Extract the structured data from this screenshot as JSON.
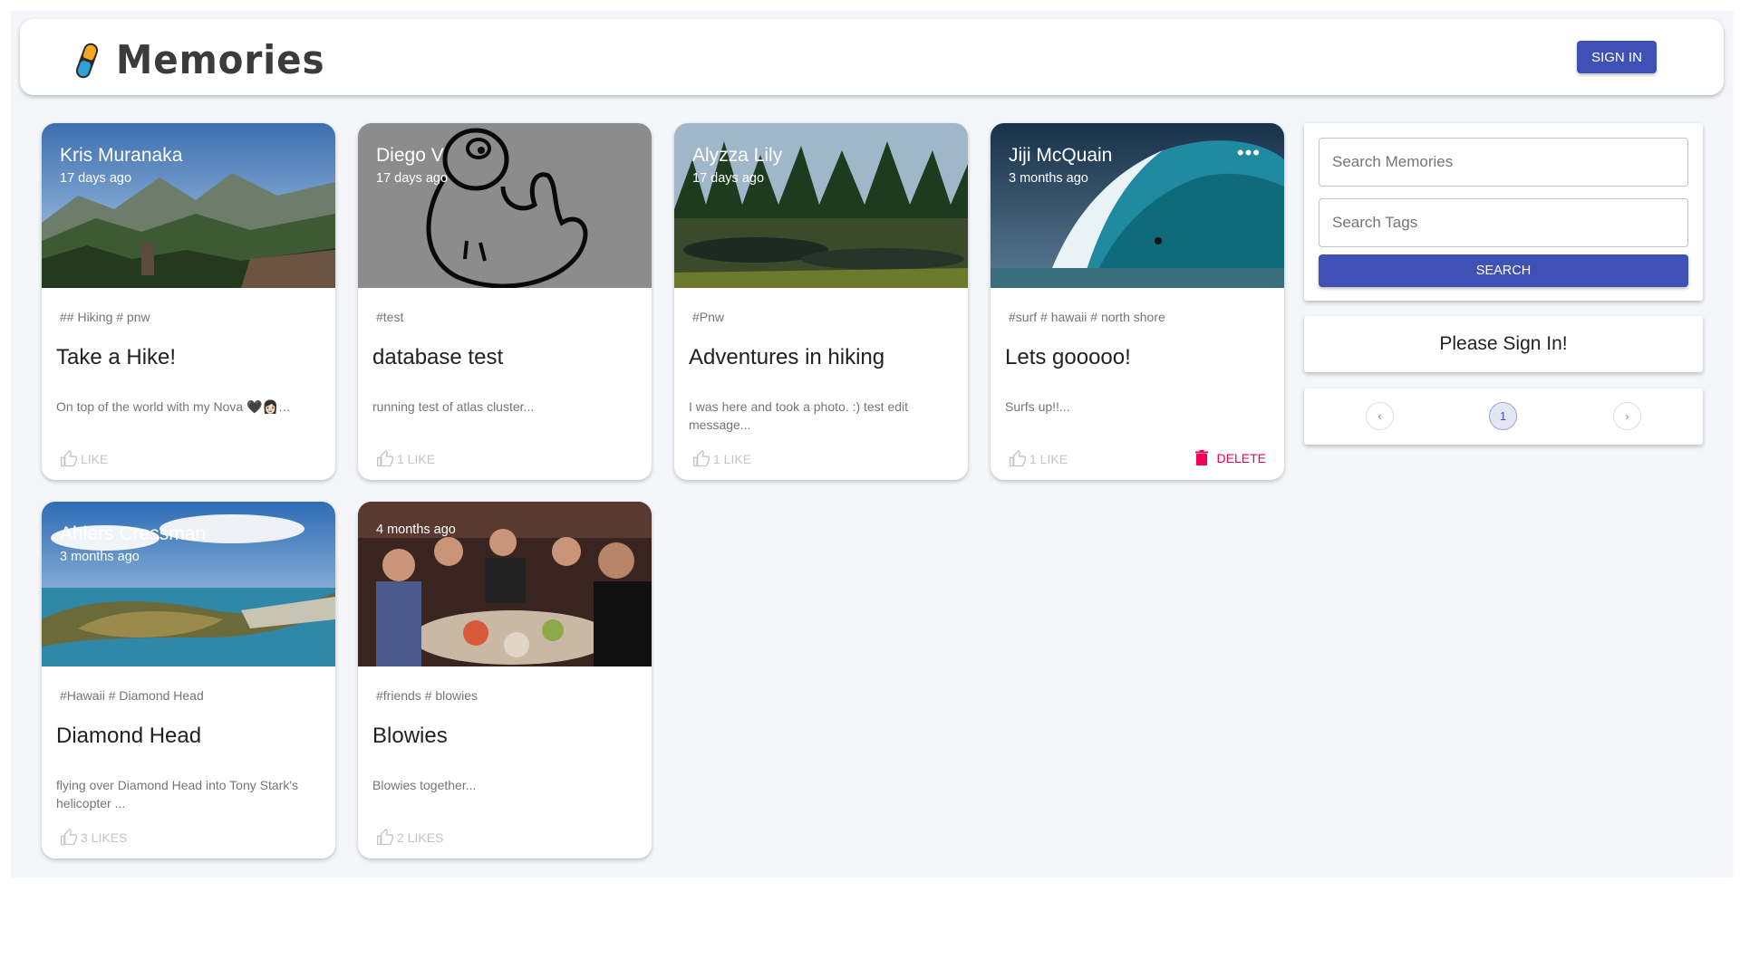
{
  "header": {
    "brand": "Memories",
    "sign_in_label": "Sign In"
  },
  "posts": [
    {
      "author": "Kris Muranaka",
      "time": "17 days ago",
      "tags": "## Hiking # pnw",
      "title": "Take a Hike!",
      "message": "On top of the world with my Nova 🖤👩🏻…",
      "likes": "Like",
      "image": "mountain-valley"
    },
    {
      "author": "Diego V",
      "time": "17 days ago",
      "tags": "#test",
      "title": "database test",
      "message": "running test of atlas cluster...",
      "likes": "1 Like",
      "image": "duck-sketch"
    },
    {
      "author": "Alyzza Lily",
      "time": "17 days ago",
      "tags": "#Pnw",
      "title": "Adventures in hiking",
      "message": "I was here and took a photo. :) test edit message...",
      "likes": "1 Like",
      "image": "forest-pond"
    },
    {
      "author": "Jiji McQuain",
      "time": "3 months ago",
      "tags": "#surf # hawaii # north shore",
      "title": "Lets gooooo!",
      "message": "Surfs up!!...",
      "likes": "1 Like",
      "delete_label": "Delete",
      "more_glyph": "•••",
      "image": "surf-wave"
    },
    {
      "author": "Ahlers Cressman",
      "time": "3 months ago",
      "tags": "#Hawaii # Diamond Head",
      "title": "Diamond Head",
      "message": "flying over Diamond Head into Tony Stark's helicopter ...",
      "likes": "3 Likes",
      "image": "diamond-head"
    },
    {
      "author": "",
      "time": "4 months ago",
      "tags": "#friends # blowies",
      "title": "Blowies",
      "message": "Blowies together...",
      "likes": "2 Likes",
      "image": "dinner-group"
    }
  ],
  "sidebar": {
    "search_placeholder": "Search Memories",
    "tags_placeholder": "Search Tags",
    "search_label": "Search",
    "signin_message": "Please Sign In!",
    "pagination": {
      "prev_glyph": "‹",
      "page": "1",
      "next_glyph": "›"
    }
  },
  "colors": {
    "primary": "#3f51b5",
    "secondary": "#f50057",
    "background": "#f4f6fa"
  }
}
